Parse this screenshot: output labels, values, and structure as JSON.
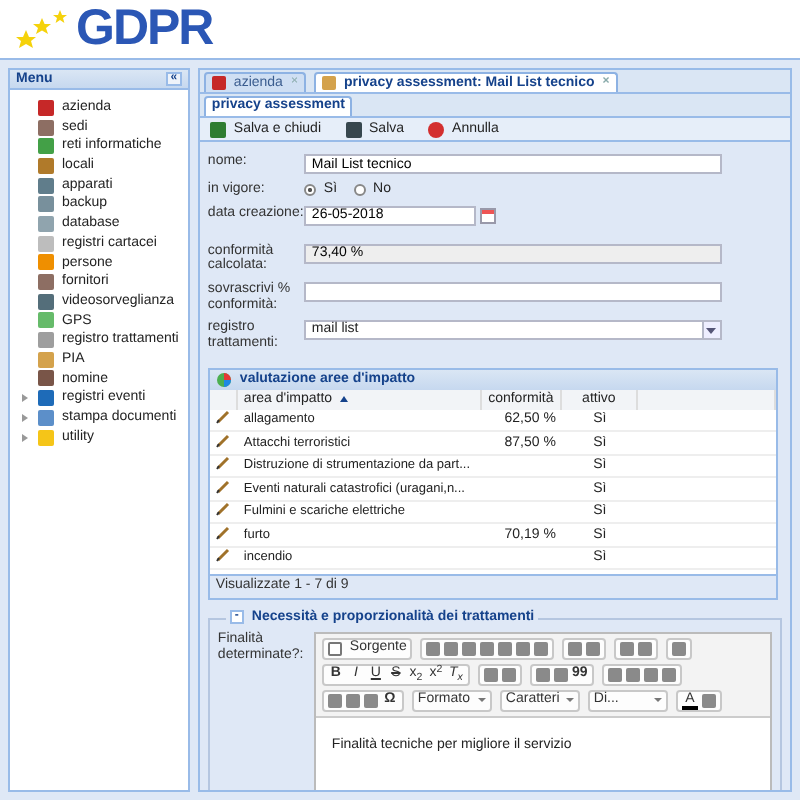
{
  "logo": {
    "text": "GDPR"
  },
  "menu": {
    "title": "Menu",
    "collapse": "«",
    "items": [
      {
        "label": "azienda"
      },
      {
        "label": "sedi"
      },
      {
        "label": "reti informatiche"
      },
      {
        "label": "locali"
      },
      {
        "label": "apparati"
      },
      {
        "label": "backup"
      },
      {
        "label": "database"
      },
      {
        "label": "registri cartacei"
      },
      {
        "label": "persone"
      },
      {
        "label": "fornitori"
      },
      {
        "label": "videosorveglianza"
      },
      {
        "label": "GPS"
      },
      {
        "label": "registro trattamenti"
      },
      {
        "label": "PIA"
      },
      {
        "label": "nomine"
      },
      {
        "label": "registri eventi",
        "expanded": false
      },
      {
        "label": "stampa documenti",
        "expanded": false
      },
      {
        "label": "utility",
        "expanded": false
      }
    ]
  },
  "tabs": [
    {
      "label": "azienda",
      "selected": false,
      "close": "×"
    },
    {
      "label": "privacy assessment: Mail List tecnico",
      "selected": true,
      "close": "×"
    }
  ],
  "subtabs": [
    {
      "label": "privacy assessment",
      "selected": true
    }
  ],
  "toolbar": [
    {
      "label": "Salva e chiudi"
    },
    {
      "label": "Salva"
    },
    {
      "label": "Annulla"
    }
  ],
  "form": [
    {
      "kind": "text",
      "label": "nome:",
      "value": "Mail List tecnico"
    },
    {
      "kind": "radio",
      "label": "in vigore:",
      "options": [
        {
          "label": "Sì",
          "selected": true
        },
        {
          "label": "No",
          "selected": false
        }
      ]
    },
    {
      "kind": "date",
      "label": "data creazione:",
      "value": "26-05-2018"
    },
    {
      "kind": "readonly",
      "label": "conformità calcolata:",
      "value": "73,40 %"
    },
    {
      "kind": "text",
      "label": "sovrascrivi % conformità:"
    },
    {
      "kind": "combo",
      "label": "registro trattamenti:",
      "value": "mail list"
    }
  ],
  "grid": {
    "title": "valutazione aree d'impatto",
    "columns": [
      {
        "label": "area d'impatto",
        "sorted": true
      },
      {
        "label": "conformità",
        "sorted": false
      },
      {
        "label": "attivo",
        "sorted": false
      }
    ],
    "rows": [
      {
        "area": "allagamento",
        "conformita": "62,50 %",
        "attivo": "Sì"
      },
      {
        "area": "Attacchi terroristici",
        "conformita": "87,50 %",
        "attivo": "Sì"
      },
      {
        "area": "Distruzione di strumentazione da part...",
        "attivo": "Sì"
      },
      {
        "area": "Eventi naturali catastrofici (uragani,n...",
        "attivo": "Sì"
      },
      {
        "area": "Fulmini e scariche elettriche",
        "attivo": "Sì"
      },
      {
        "area": "furto",
        "conformita": "70,19 %",
        "attivo": "Sì"
      },
      {
        "area": "incendio",
        "attivo": "Sì"
      }
    ],
    "footer": "Visualizzate 1 - 7 di 9"
  },
  "fieldset": {
    "title": "Necessità e proporzionalità dei trattamenti",
    "expanded": true,
    "toggle": "-",
    "label": "Finalità determinate?:",
    "editor": {
      "toolbar": [
        [
          [
            {
              "kind": "source",
              "text": "Sorgente"
            }
          ],
          [
            {
              "kind": "icon"
            },
            {
              "kind": "icon"
            },
            {
              "kind": "icon"
            },
            {
              "kind": "icon"
            },
            {
              "kind": "icon"
            },
            {
              "kind": "icon"
            },
            {
              "kind": "icon"
            }
          ],
          [
            {
              "kind": "icon"
            },
            {
              "kind": "icon"
            }
          ],
          [
            {
              "kind": "icon"
            },
            {
              "kind": "icon"
            }
          ],
          [
            {
              "kind": "icon"
            }
          ]
        ],
        [
          [
            {
              "kind": "text",
              "text": "B"
            },
            {
              "kind": "text",
              "text": "I"
            },
            {
              "kind": "text",
              "text": "U"
            },
            {
              "kind": "text",
              "text": "S"
            },
            {
              "kind": "text",
              "text": "x$_{2}$"
            },
            {
              "kind": "text",
              "text": "x$^{2}$"
            },
            {
              "kind": "text",
              "text": "T$_{x}$"
            }
          ],
          [
            {
              "kind": "icon"
            },
            {
              "kind": "icon"
            }
          ],
          [
            {
              "kind": "icon"
            },
            {
              "kind": "icon"
            },
            {
              "kind": "text",
              "text": "99"
            }
          ],
          [
            {
              "kind": "icon"
            },
            {
              "kind": "icon"
            },
            {
              "kind": "icon"
            },
            {
              "kind": "icon"
            }
          ]
        ],
        [
          [
            {
              "kind": "icon"
            },
            {
              "kind": "icon"
            },
            {
              "kind": "icon"
            },
            {
              "kind": "text",
              "text": "Ω"
            }
          ],
          [
            {
              "kind": "dropdown",
              "text": "Formato"
            }
          ],
          [
            {
              "kind": "dropdown",
              "text": "Caratteri"
            }
          ],
          [
            {
              "kind": "dropdown",
              "text": "Di..."
            }
          ],
          [
            {
              "kind": "color",
              "text": "A"
            },
            {
              "kind": "icon"
            }
          ]
        ]
      ],
      "content": "Finalità tecniche per migliore il servizio"
    }
  }
}
